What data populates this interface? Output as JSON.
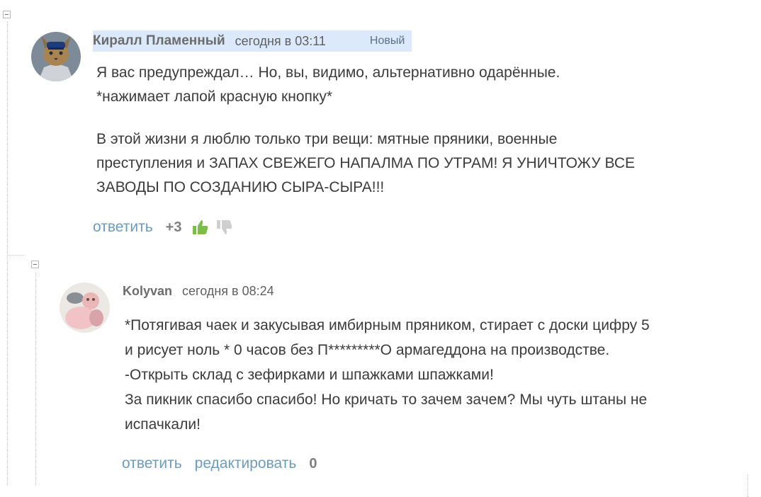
{
  "comments": [
    {
      "author": "Киралл Пламенный",
      "date": "сегодня в 03:11",
      "badge": "Новый",
      "paragraphs": [
        [
          "Я вас предупреждал… Но, вы, видимо, альтернативно одарённые.",
          "*нажимает лапой красную кнопку*"
        ],
        [
          "В этой жизни я люблю только три вещи: мятные пряники, военные",
          "преступления и ЗАПАХ СВЕЖЕГО НАПАЛМА ПО УТРАМ! Я УНИЧТОЖУ ВСЕ",
          "ЗАВОДЫ ПО СОЗДАНИЮ СЫРА-СЫРА!!!"
        ]
      ],
      "actions": {
        "reply": "ответить",
        "score": "+3"
      },
      "colors": {
        "vote_up": "#7cbd4a",
        "vote_down": "#cfcfcf"
      }
    },
    {
      "author": "Kolyvan",
      "date": "сегодня в 08:24",
      "lines": [
        "*Потягивая чаек и закусывая имбирным пряником, стирает с доски цифру 5",
        "и рисует ноль * 0 часов без П*********О армагеддона на производстве.",
        "-Открыть склад с зефирками и шпажками шпажками!",
        "За пикник спасибо спасибо! Но кричать то зачем зачем? Мы чуть штаны не",
        "испачкали!"
      ],
      "actions": {
        "reply": "ответить",
        "edit": "редактировать",
        "score": "0"
      }
    }
  ]
}
